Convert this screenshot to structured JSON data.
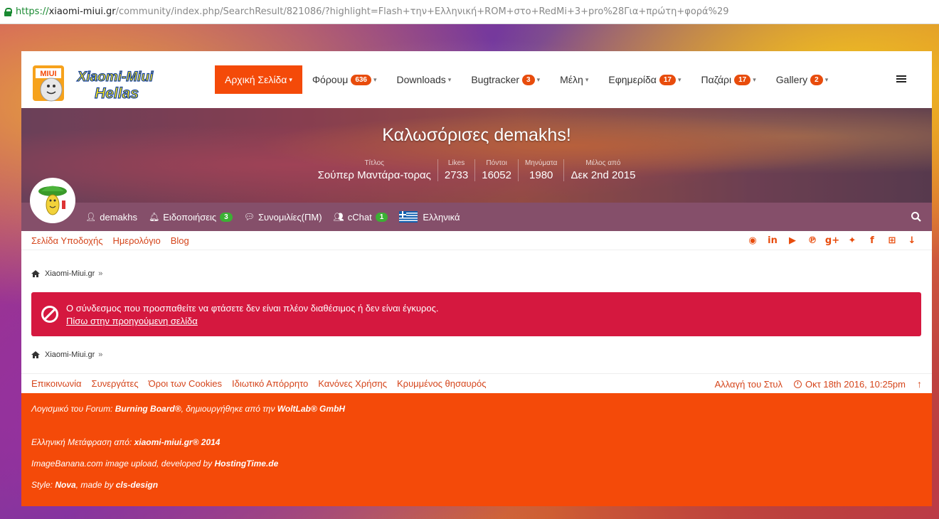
{
  "browser": {
    "url_protocol": "https://",
    "url_host": "xiaomi-miui.gr",
    "url_path": "/community/index.php/SearchResult/821086/?highlight=Flash+την+Ελληνική+ROM+στο+RedMi+3+pro%28Για+πρώτη+φορά%29"
  },
  "logo": {
    "line1": "Xiaomi-Miui",
    "line2": "Hellas",
    "badge": "MIUI"
  },
  "nav": {
    "items": [
      {
        "label": "Αρχική Σελίδα",
        "badge": "",
        "active": true
      },
      {
        "label": "Φόρουμ",
        "badge": "636",
        "active": false
      },
      {
        "label": "Downloads",
        "badge": "",
        "active": false
      },
      {
        "label": "Bugtracker",
        "badge": "3",
        "active": false
      },
      {
        "label": "Μέλη",
        "badge": "",
        "active": false
      },
      {
        "label": "Εφημερίδα",
        "badge": "17",
        "active": false
      },
      {
        "label": "Παζάρι",
        "badge": "17",
        "active": false
      },
      {
        "label": "Gallery",
        "badge": "2",
        "active": false
      }
    ]
  },
  "banner": {
    "welcome": "Καλωσόρισες demakhs!",
    "stats": [
      {
        "label": "Τίτλος",
        "value": "Σούπερ Μαντάρα-τορας"
      },
      {
        "label": "Likes",
        "value": "2733"
      },
      {
        "label": "Πόντοι",
        "value": "16052"
      },
      {
        "label": "Μηνύματα",
        "value": "1980"
      },
      {
        "label": "Μέλος από",
        "value": "Δεκ 2nd 2015"
      }
    ]
  },
  "userbar": {
    "username": "demakhs",
    "notifications_label": "Ειδοποιήσεις",
    "notifications_count": "3",
    "conversations_label": "Συνομιλίες(ΠΜ)",
    "chat_label": "cChat",
    "chat_count": "1",
    "language": "Ελληνικά"
  },
  "sublinks": [
    "Σελίδα Υποδοχής",
    "Ημερολόγιο",
    "Blog"
  ],
  "social_icons": [
    "github-icon",
    "linkedin-icon",
    "youtube-icon",
    "pinterest-icon",
    "google-plus-icon",
    "twitter-icon",
    "facebook-icon",
    "sitemap-icon",
    "arrow-down-icon"
  ],
  "breadcrumb": {
    "label": "Xiaomi-Miui.gr",
    "sep": "»"
  },
  "error": {
    "message": "Ο σύνδεσμος που προσπαθείτε να φτάσετε δεν είναι πλέον διαθέσιμος ή δεν είναι έγκυρος.",
    "back_link": "Πίσω στην προηγούμενη σελίδα"
  },
  "footer": {
    "links": [
      "Επικοινωνία",
      "Συνεργάτες",
      "Όροι των Cookies",
      "Ιδιωτικό Απόρρητο",
      "Κανόνες Χρήσης",
      "Κρυμμένος θησαυρός"
    ],
    "style_switch": "Αλλαγή του Στυλ",
    "time": "Οκτ 18th 2016, 10:25pm"
  },
  "credits": {
    "line1_prefix": "Λογισμικό του Forum: ",
    "line1_product": "Burning Board®",
    "line1_mid": ", δημιουργήθηκε από την ",
    "line1_company": "WoltLab® GmbH",
    "line2_prefix": "Ελληνική Μετάφραση από: ",
    "line2_site": "xiaomi-miui.gr® 2014",
    "line3_prefix": "ImageBanana.com image upload, developed by ",
    "line3_company": "HostingTime.de",
    "line4_prefix": "Style: ",
    "line4_style": "Nova",
    "line4_mid": ", made by ",
    "line4_author": "cls-design"
  },
  "colors": {
    "accent": "#f44a09",
    "error": "#d5183f",
    "link": "#d5451b"
  }
}
